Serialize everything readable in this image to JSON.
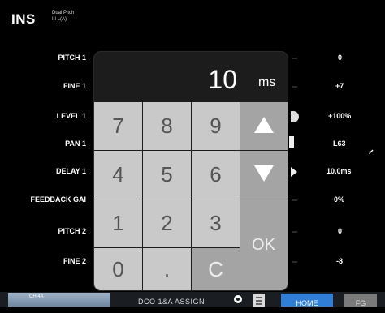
{
  "header": {
    "title": "INS",
    "plugin_type_line1": "Dual Pitch",
    "plugin_type_line2": "III L(A)"
  },
  "params": [
    {
      "label": "PITCH 1",
      "value": "0"
    },
    {
      "label": "FINE 1",
      "value": "+7"
    },
    {
      "label": "LEVEL 1",
      "value": "+100%"
    },
    {
      "label": "PAN 1",
      "value": "L63"
    },
    {
      "label": "DELAY 1",
      "value": "10.0ms"
    },
    {
      "label": "FEEDBACK GAI",
      "value": "0%"
    },
    {
      "label": "PITCH 2",
      "value": "0"
    },
    {
      "label": "FINE 2",
      "value": "-8"
    }
  ],
  "keypad": {
    "display_value": "10",
    "unit": "ms",
    "keys": {
      "k7": "7",
      "k8": "8",
      "k9": "9",
      "k4": "4",
      "k5": "5",
      "k6": "6",
      "k1": "1",
      "k2": "2",
      "k3": "3",
      "k0": "0",
      "kdot": ".",
      "kc": "C",
      "ok": "OK"
    }
  },
  "footer": {
    "channel": "CH 4A",
    "assign": "DCO 1&A ASSIGN",
    "home": "HOME",
    "right": "FG"
  },
  "colors": {
    "accent": "#2f7ed8",
    "key_light": "#c9c9c9",
    "key_dark": "#a4a4a4"
  }
}
